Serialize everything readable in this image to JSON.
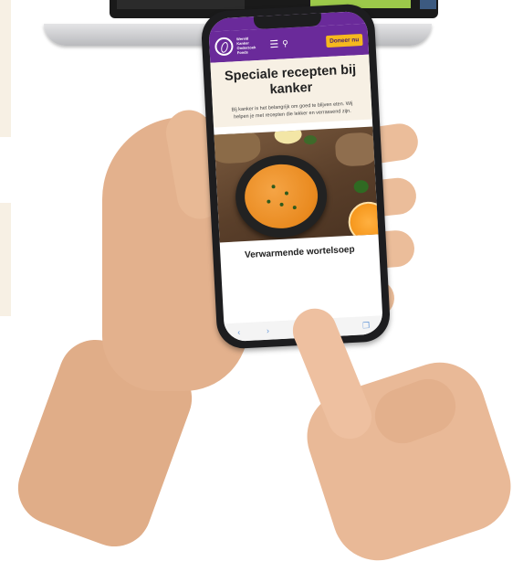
{
  "header": {
    "logo_text": "Wereld Kanker Onderzoek Fonds",
    "donate_label": "Doneer nu",
    "menu_icon": "hamburger-icon",
    "search_icon": "search-icon"
  },
  "hero": {
    "title": "Speciale recepten bij kanker",
    "text": "Bij kanker is het belangrijk om goed te blijven eten. Wij helpen je met recepten die lekker en verrassend zijn."
  },
  "recipe": {
    "title": "Verwarmende wortelsoep"
  },
  "toolbar": {
    "back_icon": "back-icon",
    "forward_icon": "forward-icon",
    "share_icon": "share-icon",
    "bookmarks_icon": "bookmarks-icon",
    "tabs_icon": "tabs-icon"
  },
  "colors": {
    "brand_purple": "#6a2a9a",
    "donate_yellow": "#f6b81e",
    "hero_background": "#f7f0e4"
  }
}
